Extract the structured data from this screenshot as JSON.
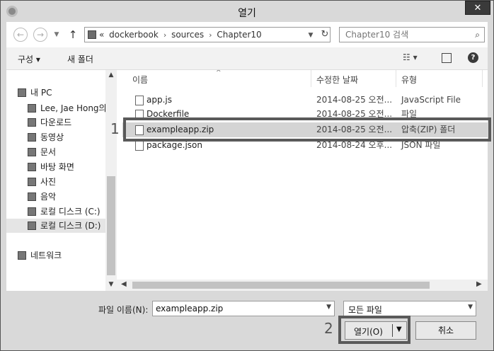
{
  "window": {
    "title": "열기",
    "close": "✕"
  },
  "nav": {
    "back": "←",
    "forward": "→",
    "recent_dropdown": "▼",
    "up": "↑",
    "address": {
      "crumbs": [
        "dockerbook",
        "sources",
        "Chapter10"
      ],
      "prefix": "«",
      "dropdown": "▼",
      "refresh": "↻"
    },
    "search": {
      "placeholder": "Chapter10 검색",
      "icon": "search-icon"
    }
  },
  "toolbar": {
    "organize": "구성 ▾",
    "new_folder": "새 폴더",
    "view": "☷ ▾",
    "help": "?"
  },
  "sidebar": {
    "items": [
      {
        "label": "내 PC",
        "icon": "computer-icon",
        "level": 0
      },
      {
        "label": "Lee, Jae Hong의",
        "icon": "user-folder-icon",
        "level": 1
      },
      {
        "label": "다운로드",
        "icon": "downloads-icon",
        "level": 1
      },
      {
        "label": "동영상",
        "icon": "videos-icon",
        "level": 1
      },
      {
        "label": "문서",
        "icon": "documents-icon",
        "level": 1
      },
      {
        "label": "바탕 화면",
        "icon": "desktop-icon",
        "level": 1
      },
      {
        "label": "사진",
        "icon": "pictures-icon",
        "level": 1
      },
      {
        "label": "음악",
        "icon": "music-icon",
        "level": 1
      },
      {
        "label": "로컬 디스크 (C:)",
        "icon": "drive-c-icon",
        "level": 1
      },
      {
        "label": "로컬 디스크 (D:)",
        "icon": "drive-d-icon",
        "level": 1,
        "selected": true
      },
      {
        "label": "네트워크",
        "icon": "network-icon",
        "level": 0
      }
    ],
    "scroll_up": "▲",
    "scroll_down": "▼"
  },
  "columns": {
    "name": "이름",
    "date": "수정한 날짜",
    "type": "유형",
    "sort_indicator": "^"
  },
  "files": [
    {
      "name": "app.js",
      "date": "2014-08-25 오전...",
      "type": "JavaScript File",
      "icon": "js-file-icon"
    },
    {
      "name": "Dockerfile",
      "date": "2014-08-25 오전...",
      "type": "파일",
      "icon": "file-icon"
    },
    {
      "name": "exampleapp.zip",
      "date": "2014-08-25 오전...",
      "type": "압축(ZIP) 폴더",
      "icon": "zip-folder-icon",
      "selected": true
    },
    {
      "name": "package.json",
      "date": "2014-08-24 오후...",
      "type": "JSON 파일",
      "icon": "json-file-icon"
    }
  ],
  "hscroll": {
    "left": "◀",
    "right": "▶"
  },
  "annotations": {
    "step1": "1",
    "step2": "2"
  },
  "footer": {
    "filename_label": "파일 이름(N):",
    "filename_value": "exampleapp.zip",
    "filename_dropdown": "▼",
    "filter_value": "모든 파일",
    "filter_dropdown": "▼",
    "open_label": "열기(O)",
    "open_dropdown": "▼",
    "cancel_label": "취소"
  }
}
